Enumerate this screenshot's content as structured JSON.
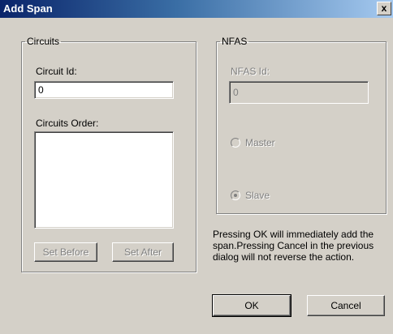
{
  "window": {
    "title": "Add Span",
    "close_glyph": "x"
  },
  "circuits": {
    "legend": "Circuits",
    "id_label": "Circuit Id:",
    "id_value": "0",
    "order_label": "Circuits Order:",
    "order_items": [],
    "set_before_label": "Set Before",
    "set_after_label": "Set After"
  },
  "nfas": {
    "legend": "NFAS",
    "id_label": "NFAS Id:",
    "id_value": "0",
    "master_label": "Master",
    "slave_label": "Slave",
    "selected": "Slave"
  },
  "info_text": "Pressing OK will immediately add the span.Pressing Cancel in the previous dialog will not reverse the action.",
  "buttons": {
    "ok_label": "OK",
    "cancel_label": "Cancel"
  },
  "colors": {
    "face": "#d4d0c8",
    "title_start": "#0a246a",
    "title_end": "#a6caf0",
    "disabled_text": "#808080"
  }
}
